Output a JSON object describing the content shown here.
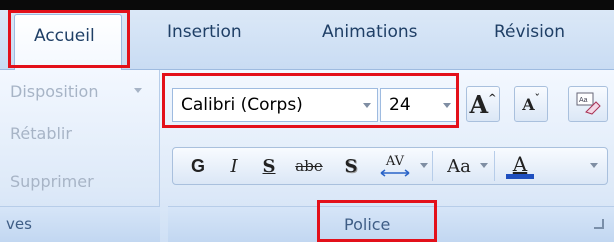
{
  "tabs": {
    "active": "Accueil",
    "items": [
      "Insertion",
      "Animations",
      "Révision"
    ]
  },
  "left_group": {
    "items": [
      "Disposition",
      "Rétablir",
      "Supprimer"
    ],
    "caption": "ves"
  },
  "font_group": {
    "font_name": "Calibri (Corps)",
    "font_size": "24",
    "caption": "Police",
    "buttons": {
      "grow": "A",
      "shrink": "A",
      "bold": "G",
      "italic": "I",
      "underline": "S",
      "strikethrough": "abe",
      "shadow": "S",
      "spacing": "AV",
      "case": "Aa",
      "color": "A"
    }
  },
  "colors": {
    "highlight_red": "#e3101a",
    "font_color_bar": "#1f4fbf"
  }
}
